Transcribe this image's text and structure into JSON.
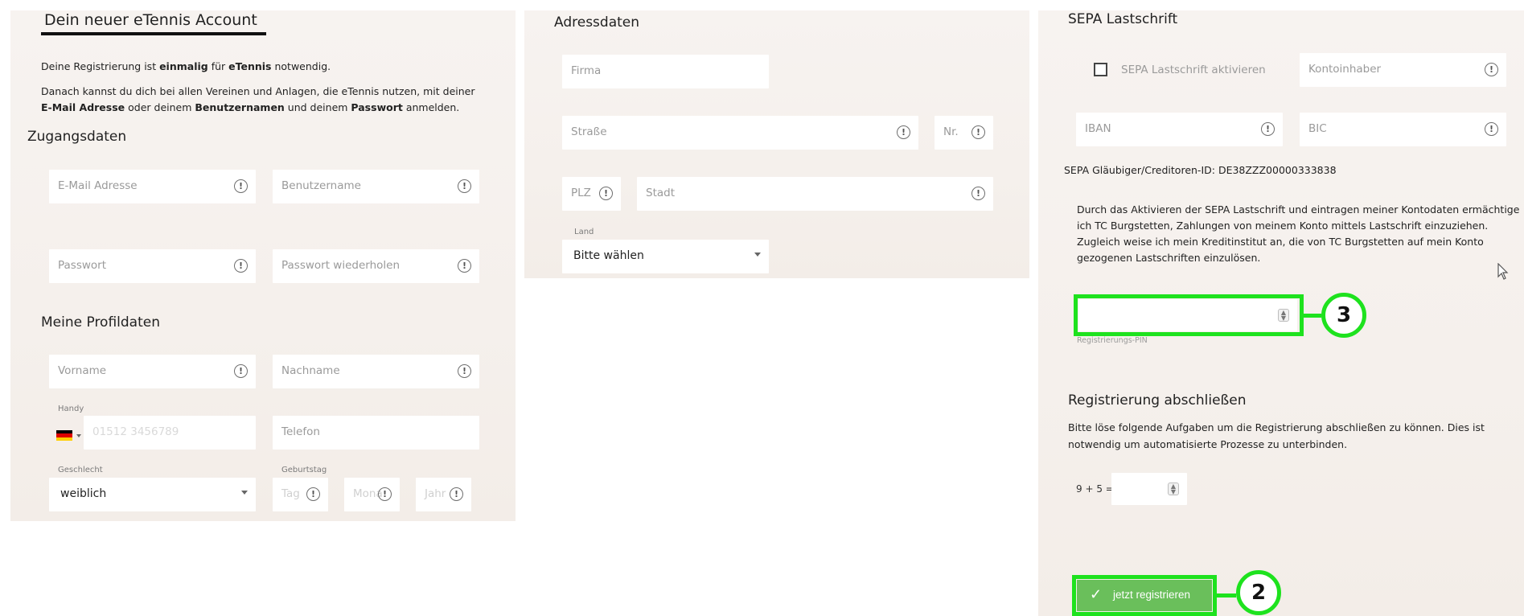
{
  "left_panel": {
    "title": "Dein neuer eTennis Account",
    "intro_line1_a": "Deine Registrierung ist ",
    "intro_line1_b": "einmalig",
    "intro_line1_c": " für ",
    "intro_line1_d": "eTennis",
    "intro_line1_e": " notwendig.",
    "intro_line2_a": "Danach kannst du dich bei allen Vereinen und Anlagen, die eTennis nutzen, mit deiner",
    "intro_line3_a": "E-Mail Adresse",
    "intro_line3_b": " oder deinem ",
    "intro_line3_c": "Benutzernamen",
    "intro_line3_d": " und deinem ",
    "intro_line3_e": "Passwort",
    "intro_line3_f": " anmelden.",
    "access_heading": "Zugangsdaten",
    "email_placeholder": "E-Mail Adresse",
    "username_placeholder": "Benutzername",
    "password_placeholder": "Passwort",
    "password_repeat_placeholder": "Passwort wiederholen",
    "profile_heading": "Meine Profildaten",
    "firstname_placeholder": "Vorname",
    "lastname_placeholder": "Nachname",
    "mobile_label": "Handy",
    "mobile_placeholder": "01512 3456789",
    "phone_placeholder": "Telefon",
    "gender_label": "Geschlecht",
    "gender_value": "weiblich",
    "birthday_label": "Geburtstag",
    "day_placeholder": "Tag",
    "month_placeholder": "Mona",
    "year_placeholder": "Jahr"
  },
  "middle_panel": {
    "heading": "Adressdaten",
    "company_placeholder": "Firma",
    "street_placeholder": "Straße",
    "number_placeholder": "Nr.",
    "zip_placeholder": "PLZ",
    "city_placeholder": "Stadt",
    "country_label": "Land",
    "country_value": "Bitte wählen"
  },
  "right_panel": {
    "heading": "SEPA Lastschrift",
    "sepa_checkbox_label": "SEPA Lastschrift aktivieren",
    "account_holder_placeholder": "Kontoinhaber",
    "iban_placeholder": "IBAN",
    "bic_placeholder": "BIC",
    "creditor_id": "SEPA Gläubiger/Creditoren-ID: DE38ZZZ00000333838",
    "mandate_line1": "Durch das Aktivieren der SEPA Lastschrift und eintragen meiner Kontodaten ermächtige",
    "mandate_line2": "ich TC Burgstetten, Zahlungen von meinem Konto mittels Lastschrift einzuziehen.",
    "mandate_line3": "Zugleich weise ich mein Kreditinstitut an, die von TC Burgstetten auf mein Konto",
    "mandate_line4": "gezogenen Lastschriften einzulösen.",
    "pin_label": "Registrierungs-PIN",
    "finish_heading": "Registrierung abschließen",
    "finish_line1": "Bitte löse folgende Aufgaben um die Registrierung abschließen zu können. Dies ist",
    "finish_line2": "notwendig um automatisierte Prozesse zu unterbinden.",
    "captcha_question": "9 + 5 =",
    "submit_label": "jetzt registrieren"
  },
  "annotations": {
    "badge_pin": "3",
    "badge_submit": "2",
    "highlight_color": "#1ee21e"
  },
  "colors": {
    "panel_bg": "#f5f0ec",
    "submit_green": "#6abf5b"
  }
}
